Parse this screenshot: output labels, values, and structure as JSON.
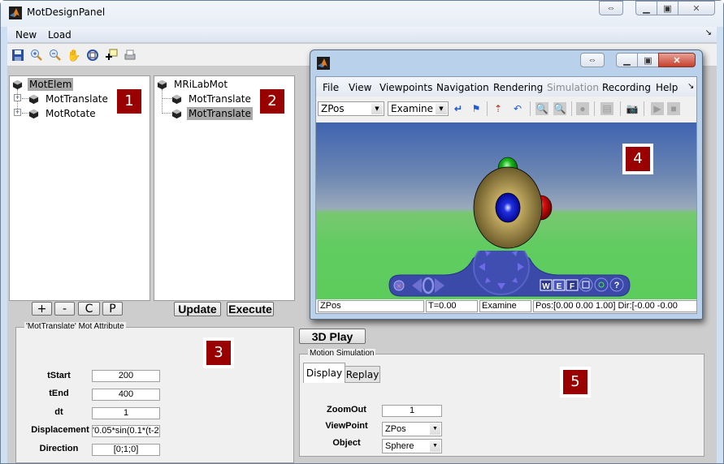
{
  "window": {
    "title": "MotDesignPanel",
    "caption_buttons": [
      "restore-size",
      "minimize",
      "maximize",
      "close"
    ]
  },
  "menubar": {
    "items": [
      "New",
      "Load"
    ],
    "overflow_glyph": "↘"
  },
  "toolbar": {
    "icons": [
      "save-icon",
      "zoom-in-icon",
      "zoom-out-icon",
      "pan-hand-icon",
      "rotate-3d-icon",
      "data-cursor-icon",
      "print-icon"
    ]
  },
  "panel1": {
    "badge": "1",
    "tree": [
      {
        "label": "MotElem",
        "level": 0,
        "selected": true
      },
      {
        "label": "MotTranslate",
        "level": 1,
        "expandable": true
      },
      {
        "label": "MotRotate",
        "level": 1,
        "expandable": true
      }
    ],
    "buttons": [
      "+",
      "-",
      "C",
      "P"
    ]
  },
  "panel2": {
    "badge": "2",
    "tree": [
      {
        "label": "MRiLabMot",
        "level": 0
      },
      {
        "label": "MotTranslate",
        "level": 1
      },
      {
        "label": "MotTranslate",
        "level": 1,
        "selected": true
      }
    ],
    "buttons": [
      "Update",
      "Execute"
    ]
  },
  "panel3": {
    "badge": "3",
    "group_title": "'MotTranslate' Mot Attribute",
    "fields": [
      {
        "label": "tStart",
        "value": "200"
      },
      {
        "label": "tEnd",
        "value": "400"
      },
      {
        "label": "dt",
        "value": "1"
      },
      {
        "label": "Displacement",
        "value": "'0.05*sin(0.1*(t-2"
      },
      {
        "label": "Direction",
        "value": "[0;1;0]"
      }
    ]
  },
  "panel5": {
    "badge": "5",
    "play_button": "3D Play",
    "group_title": "Motion Simulation",
    "tabs": [
      {
        "label": "Display",
        "active": true
      },
      {
        "label": "Replay",
        "active": false
      }
    ],
    "fields": {
      "zoomout_label": "ZoomOut",
      "zoomout_value": "1",
      "viewpoint_label": "ViewPoint",
      "viewpoint_value": "ZPos",
      "object_label": "Object",
      "object_value": "Sphere"
    }
  },
  "viewer": {
    "badge": "4",
    "menu": [
      {
        "label": "File",
        "disabled": false
      },
      {
        "label": "View",
        "disabled": false
      },
      {
        "label": "Viewpoints",
        "disabled": false
      },
      {
        "label": "Navigation",
        "disabled": false
      },
      {
        "label": "Rendering",
        "disabled": false
      },
      {
        "label": "Simulation",
        "disabled": true
      },
      {
        "label": "Recording",
        "disabled": false
      },
      {
        "label": "Help",
        "disabled": false
      }
    ],
    "viewpoint_combo": "ZPos",
    "navigation_combo": "Examine",
    "nav_panel_buttons": [
      "W",
      "E",
      "F",
      "?"
    ],
    "status": {
      "viewpoint": "ZPos",
      "time": "T=0.00",
      "mode": "Examine",
      "position": "Pos:[0.00 0.00 1.00] Dir:[-0.00 -0.00"
    }
  },
  "colors": {
    "badge_bg": "#990000",
    "selection_bg": "#a9a9a9",
    "nav_panel": "#3b4aa8"
  }
}
